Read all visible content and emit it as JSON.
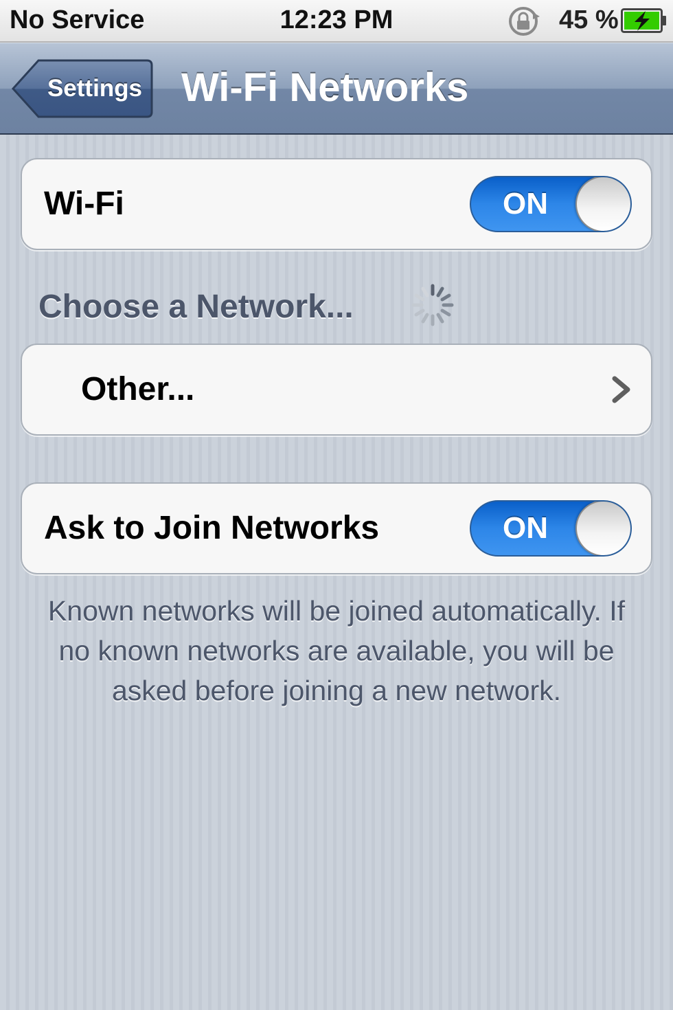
{
  "status_bar": {
    "carrier": "No Service",
    "time": "12:23 PM",
    "battery_percent": "45 %",
    "icons": [
      "rotation-lock-icon",
      "battery-charging-icon"
    ],
    "battery_level": 0.45
  },
  "nav_bar": {
    "back_label": "Settings",
    "title": "Wi-Fi Networks"
  },
  "wifi_cell": {
    "label": "Wi-Fi",
    "toggle_state": "ON"
  },
  "networks_section": {
    "header": "Choose a Network...",
    "spinner_icon": "activity-spinner-icon"
  },
  "other_cell": {
    "label": "Other...",
    "accessory_icon": "chevron-right-icon"
  },
  "ask_cell": {
    "label": "Ask to Join Networks",
    "toggle_state": "ON"
  },
  "footer": {
    "text": "Known networks will be joined automatically. If no known networks are available, you will be asked before joining a new network."
  },
  "colors": {
    "toggle_on": "#2d86e8",
    "nav_bar": "#8ea1bb",
    "background": "#c5ccd6",
    "battery_charging": "#33cc00"
  }
}
